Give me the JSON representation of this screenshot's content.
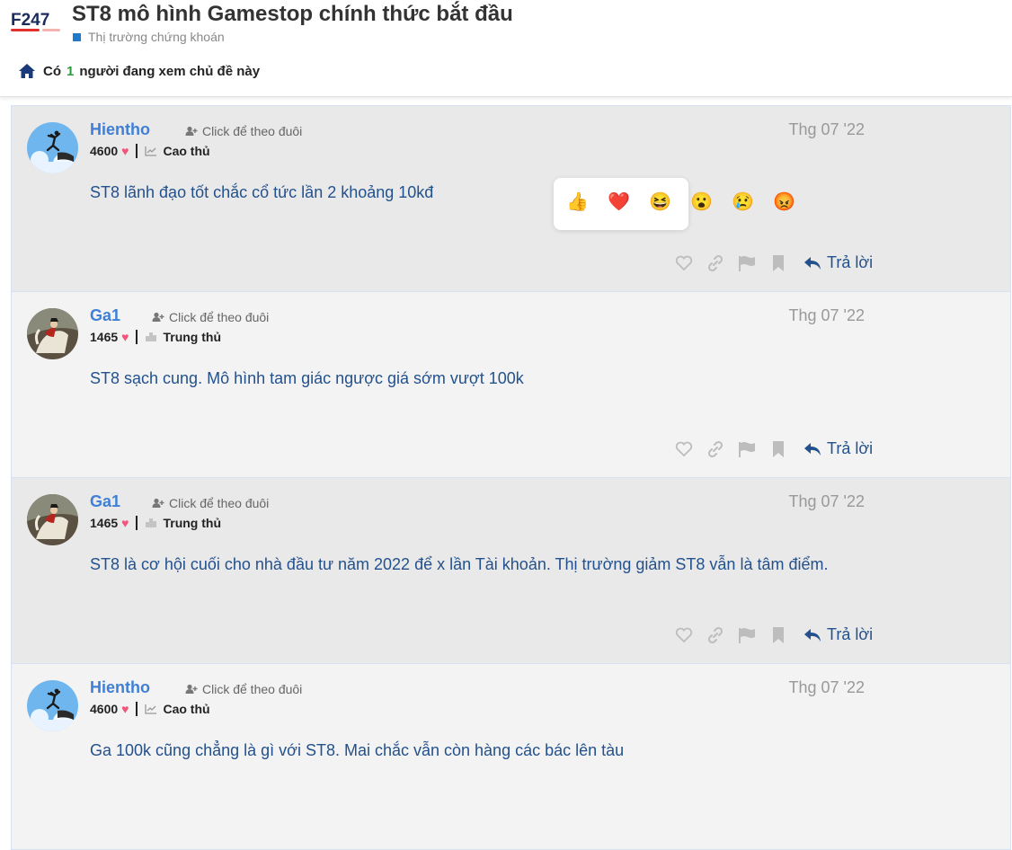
{
  "header": {
    "logo_text": "F247",
    "title": "ST8 mô hình Gamestop chính thức bắt đầu",
    "category": "Thị trường chứng khoán",
    "viewers": {
      "prefix": "Có",
      "count": "1",
      "suffix": "người đang xem chủ đề này"
    }
  },
  "reactions": [
    "👍",
    "❤️",
    "😆",
    "😮",
    "😢",
    "😡"
  ],
  "posts": [
    {
      "username": "Hientho",
      "follow": "Click để theo đuôi",
      "points": "4600",
      "rank": "Cao thủ",
      "date": "Thg 07 '22",
      "content": "ST8 lãnh đạo tốt chắc cổ tức lần 2 khoảng 10kđ",
      "reply": "Trả lời"
    },
    {
      "username": "Ga1",
      "follow": "Click để theo đuôi",
      "points": "1465",
      "rank": "Trung thủ",
      "date": "Thg 07 '22",
      "content": "ST8 sạch cung. Mô hình tam giác ngược giá sớm vượt 100k",
      "reply": "Trả lời"
    },
    {
      "username": "Ga1",
      "follow": "Click để theo đuôi",
      "points": "1465",
      "rank": "Trung thủ",
      "date": "Thg 07 '22",
      "content": "ST8 là cơ hội cuối cho nhà đầu tư năm 2022 để x lần Tài khoản. Thị trường giảm ST8 vẫn là tâm điểm.",
      "reply": "Trả lời"
    },
    {
      "username": "Hientho",
      "follow": "Click để theo đuôi",
      "points": "4600",
      "rank": "Cao thủ",
      "date": "Thg 07 '22",
      "content": "Ga 100k cũng chẳng là gì với ST8. Mai chắc vẫn còn hàng các bác lên tàu",
      "reply": "Trả lời"
    }
  ],
  "colors": {
    "accent": "#3f7fd6",
    "content": "#23518d",
    "heart": "#f0567a",
    "viewer_count": "#2a9d3a"
  }
}
